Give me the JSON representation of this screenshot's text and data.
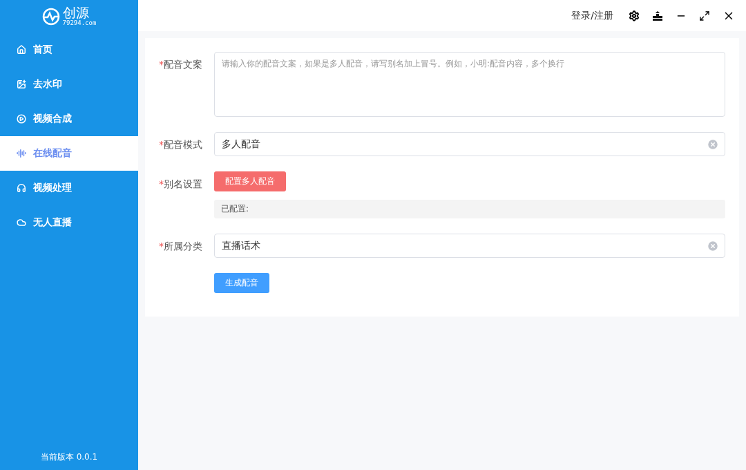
{
  "logo": {
    "name": "创源",
    "domain": "79294.com"
  },
  "sidebar": {
    "items": [
      {
        "label": "首页",
        "selected": false
      },
      {
        "label": "去水印",
        "selected": false
      },
      {
        "label": "视频合成",
        "selected": false
      },
      {
        "label": "在线配音",
        "selected": true
      },
      {
        "label": "视频处理",
        "selected": false
      },
      {
        "label": "无人直播",
        "selected": false
      }
    ],
    "version": "当前版本 0.0.1"
  },
  "topbar": {
    "login": "登录/注册"
  },
  "form": {
    "fields": [
      {
        "kind": "textarea",
        "mark": "*",
        "label": "配音文案",
        "placeholder": "请输入你的配音文案，如果是多人配音，请写别名加上冒号。例如，小明:配音内容，多个换行"
      },
      {
        "kind": "select",
        "mark": "*",
        "label": "配音模式",
        "value": "多人配音"
      },
      {
        "kind": "config",
        "mark": "*",
        "label": "别名设置",
        "button": "配置多人配音",
        "note": "已配置:"
      },
      {
        "kind": "select",
        "mark": "*",
        "label": "所属分类",
        "value": "直播话术"
      }
    ],
    "submit": "生成配音"
  }
}
